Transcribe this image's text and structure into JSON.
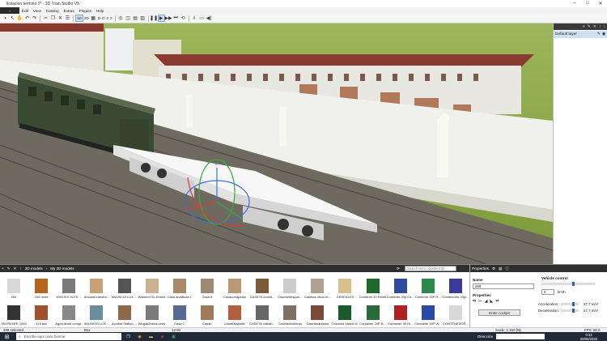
{
  "window": {
    "title": "Estacion termino 2* - 3D Train Studio V5",
    "controls": [
      "–",
      "□",
      "✕"
    ]
  },
  "menu": [
    "Edit",
    "View",
    "Catalog",
    "Extras",
    "Plugins",
    "Help"
  ],
  "toolbar": {
    "labels": [
      "3D",
      "2D",
      "D",
      "D",
      "3",
      "3"
    ]
  },
  "layers": {
    "default": "Default layer"
  },
  "library": {
    "breadcrumb": "3D models",
    "breadcrumb2": "My 3D models",
    "search_placeholder": "Search term / Content ID",
    "items_row1": [
      "269",
      "319 renfe",
      "3000 R.E.N.F.E ...",
      "Anclará transfor...",
      "ANUNCIO LUX ...",
      "Bahnhof Su Ermita",
      "Casa andaluza 1",
      "Casa d",
      "Casacorrajardin",
      "CASETA comid...",
      "Caseta/despos...",
      "Casetas oficio m...",
      "CEREALES",
      "Contener 20 Renfe",
      "Contener 20p Co...",
      "Contener 40P R...",
      "Contenedor 20pi..."
    ],
    "items_row2": [
      "353 RENFE 1953",
      "319 taxi",
      "Agricultural compi...",
      "ANUNCIO LUX ...",
      "Auxiliar Station ...",
      "Biogas2bbron-ests",
      "Casa C",
      "Casab",
      "Casa63fajardin",
      "CASETA viauab...",
      "Casetadedobras",
      "Casetasanitario",
      "Columna caseo bl...",
      "Container 20P B...",
      "Container 40 Hi...",
      "Container 40P W...",
      "CONTENEDOR..."
    ],
    "colors": [
      "#d8d8d8",
      "#b5651d",
      "#7a7a7a",
      "#c8a078",
      "#555",
      "#c9b28f",
      "#a98a6a",
      "#9e8a70",
      "#b89a7a",
      "#7b5b3a",
      "#ccc",
      "#b0a090",
      "#d6c18c",
      "#1f6a2a",
      "#2f4aa0",
      "#2b8a4a",
      "#3a3a9a",
      "#333",
      "#a0522d",
      "#888",
      "#6b8e9e",
      "#8a6a4a",
      "#7a7a7a",
      "#556b8f",
      "#9c7a5a",
      "#b06040",
      "#666",
      "#807060",
      "#7a4a3a",
      "#1d5a2a",
      "#2a6a3a",
      "#b02020",
      "#2b4aa8"
    ]
  },
  "properties": {
    "title": "Properties",
    "name_label": "Name",
    "name_value": "269",
    "section": "Properties",
    "enter_button": "Enter cockpit",
    "vehicle_control": "Vehicle control",
    "speed_value": "0",
    "speed_unit": "km/h",
    "accel_label": "Acceleration:",
    "accel_value": "27,7 m/s²",
    "decel_label": "Deceleration:",
    "decel_value": "27,7 m/s²"
  },
  "status": {
    "selected": "269 selected",
    "type": "Box",
    "center": "12:00",
    "direction_label": "Dirección",
    "scale": "Scale: 1:160 (N)",
    "fps": "FPS: 60,0"
  },
  "taskbar": {
    "search": "Escribe aquí para buscar",
    "time": "0:33",
    "date": "08/08/2020"
  },
  "gizmo": {
    "axis": "z"
  }
}
